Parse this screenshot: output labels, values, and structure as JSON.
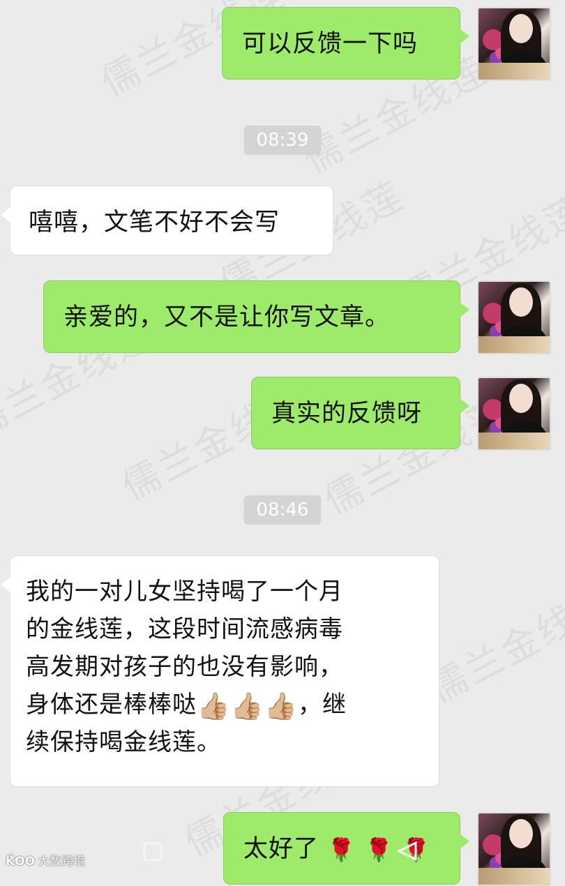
{
  "watermark_text": "儒兰金线莲",
  "messages": [
    {
      "id": "m1",
      "side": "me",
      "text": "可以反馈一下吗"
    },
    {
      "id": "t1",
      "type": "time",
      "text": "08:39"
    },
    {
      "id": "m2",
      "side": "them",
      "text": "嘻嘻，文笔不好不会写"
    },
    {
      "id": "m3",
      "side": "me",
      "text": "亲爱的，又不是让你写文章。"
    },
    {
      "id": "m4",
      "side": "me",
      "text": "真实的反馈呀"
    },
    {
      "id": "t2",
      "type": "time",
      "text": "08:46"
    },
    {
      "id": "m5",
      "side": "them",
      "line1": "我的一对儿女坚持喝了一个月",
      "line2": "的金线莲，这段时间流感病毒",
      "line3": "高发期对孩子的也没有影响，",
      "line4a": "身体还是棒棒哒",
      "thumbs": "👍🏼👍🏼👍🏼",
      "line4b": "，继",
      "line5": "续保持喝金线莲。"
    },
    {
      "id": "m6",
      "side": "me",
      "text": "太好了",
      "roses": "🌹🌹🌹"
    }
  ],
  "navbar": {
    "brand_logo": "K̊OO",
    "brand_name": "大数跨境"
  },
  "icons": [
    "home-square-icon",
    "back-triangle-icon"
  ]
}
